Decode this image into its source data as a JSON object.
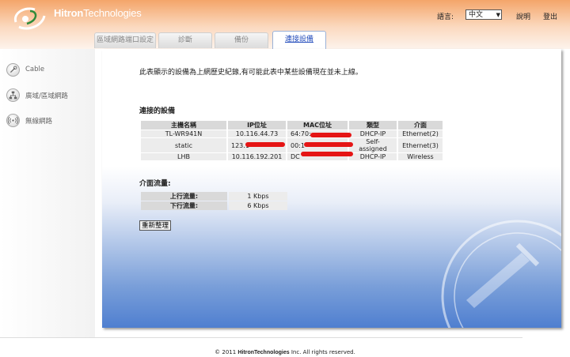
{
  "header": {
    "brand_bold": "Hitron",
    "brand_rest": "Technologies",
    "language_label": "語言:",
    "language_selected": "中文",
    "help_label": "說明",
    "logout_label": "登出"
  },
  "tabs": [
    {
      "label": "區域網路端口設定",
      "active": false
    },
    {
      "label": "診斷",
      "active": false
    },
    {
      "label": "備份",
      "active": false
    },
    {
      "label": "連接設備",
      "active": true
    }
  ],
  "sidebar": {
    "items": [
      {
        "label": "Cable",
        "icon": "wrench-icon"
      },
      {
        "label": "廣域/區域網路",
        "icon": "network-icon"
      },
      {
        "label": "無線網路",
        "icon": "wireless-icon"
      }
    ]
  },
  "main": {
    "intro": "此表顯示的設備為上網歷史紀錄,有可能此表中某些設備現在並未上線。",
    "devices_title": "連接的設備",
    "device_columns": [
      "主機名稱",
      "IP位址",
      "MAC位址",
      "類型",
      "介面"
    ],
    "devices": [
      {
        "host": "TL-WR941N",
        "ip": "10.116.44.73",
        "mac": "64:70:",
        "type": "DHCP-IP",
        "iface": "Ethernet(2)"
      },
      {
        "host": "static",
        "ip": "123.1",
        "mac": "00:1",
        "type": "Self-assigned",
        "iface": "Ethernet(3)"
      },
      {
        "host": "LHB",
        "ip": "10.116.192.201",
        "mac": "DC",
        "type": "DHCP-IP",
        "iface": "Wireless"
      }
    ],
    "traffic_title": "介面流量:",
    "traffic": [
      {
        "label": "上行流量:",
        "value": "1 Kbps"
      },
      {
        "label": "下行流量:",
        "value": "6 Kbps"
      }
    ],
    "refresh_label": "重新整理"
  },
  "footer": {
    "prefix": "© 2011 ",
    "brand_bold": "HitronTechnologies",
    "suffix": " Inc.  All rights reserved."
  },
  "colors": {
    "header_orange": "#f4a56a",
    "active_tab_text": "#2a52be",
    "panel_blue": "#4f7fd0",
    "redaction_red": "#e51515"
  }
}
